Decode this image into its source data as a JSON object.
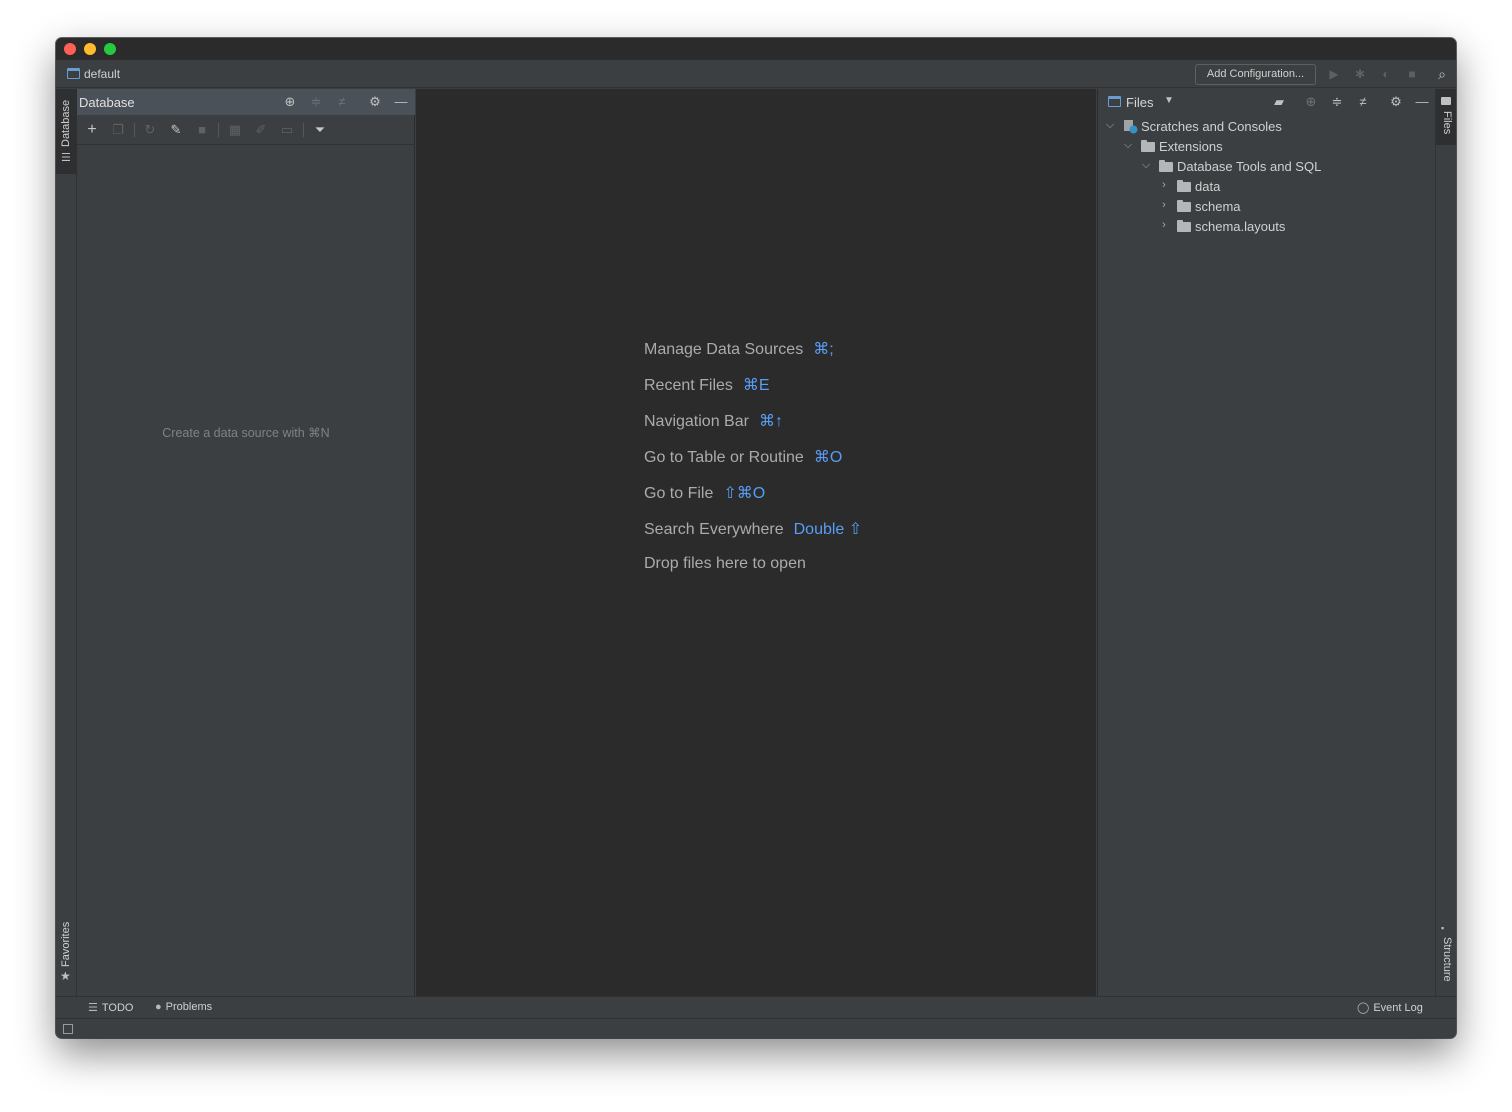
{
  "navbar": {
    "project_name": "default",
    "add_configuration": "Add Configuration..."
  },
  "left_strip": {
    "database_tab": "Database",
    "favorites_tab": "Favorites"
  },
  "database_panel": {
    "title": "Database",
    "empty_text": "Create a data source with ⌘N"
  },
  "editor": {
    "hints": [
      {
        "label": "Manage Data Sources",
        "shortcut": "⌘;"
      },
      {
        "label": "Recent Files",
        "shortcut": "⌘E"
      },
      {
        "label": "Navigation Bar",
        "shortcut": "⌘↑"
      },
      {
        "label": "Go to Table or Routine",
        "shortcut": "⌘O"
      },
      {
        "label": "Go to File",
        "shortcut": "⇧⌘O"
      },
      {
        "label": "Search Everywhere",
        "shortcut": "Double ⇧"
      },
      {
        "label": "Drop files here to open",
        "shortcut": ""
      }
    ]
  },
  "files_panel": {
    "title": "Files",
    "tree": [
      {
        "label": "Scratches and Consoles",
        "icon": "scratch-icon",
        "expanded": true
      },
      {
        "label": "Extensions",
        "icon": "folder-icon",
        "expanded": true
      },
      {
        "label": "Database Tools and SQL",
        "icon": "folder-icon",
        "expanded": true
      },
      {
        "label": "data",
        "icon": "folder-icon",
        "expanded": false
      },
      {
        "label": "schema",
        "icon": "folder-icon",
        "expanded": false
      },
      {
        "label": "schema.layouts",
        "icon": "folder-icon",
        "expanded": false
      }
    ]
  },
  "right_strip": {
    "files_tab": "Files",
    "structure_tab": "Structure"
  },
  "bottom_bar": {
    "todo": "TODO",
    "problems": "Problems",
    "event_log": "Event Log"
  },
  "colors": {
    "window_bg": "#3c3f41",
    "editor_bg": "#2b2b2b",
    "panel_header_active": "#4b5158",
    "shortcut_accent": "#589df6"
  }
}
